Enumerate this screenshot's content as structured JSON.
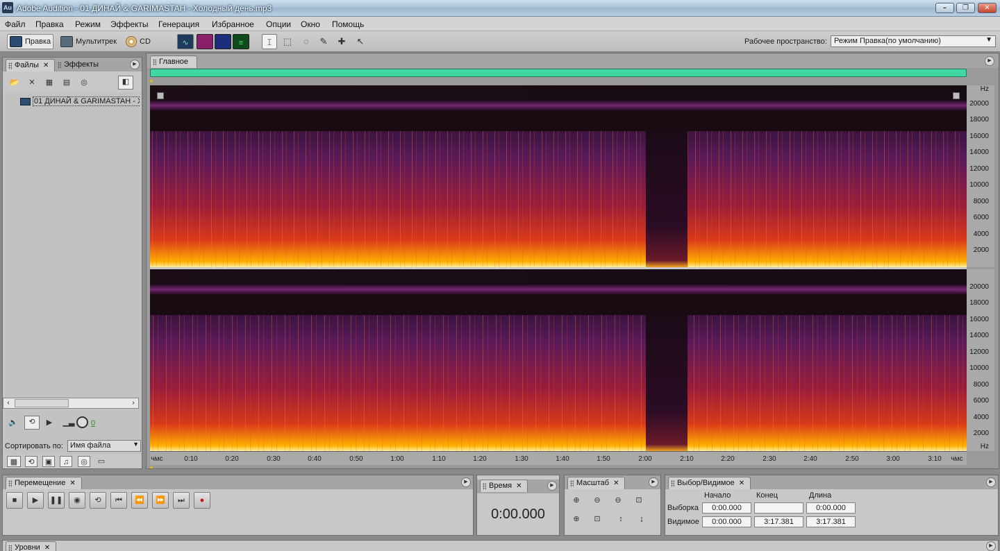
{
  "window": {
    "title": "Adobe Audition - 01 ДИНАЙ & GARIMASTAH - Холодный день.mp3",
    "app_icon": "Au"
  },
  "menu": [
    "Файл",
    "Правка",
    "Режим",
    "Эффекты",
    "Генерация",
    "Избранное",
    "Опции",
    "Окно",
    "Помощь"
  ],
  "toolbar": {
    "mode_edit": "Правка",
    "mode_multitrack": "Мультитрек",
    "mode_cd": "CD",
    "workspace_label": "Рабочее пространство:",
    "workspace_value": "Режим Правка(по умолчанию)"
  },
  "files_panel": {
    "tab_files": "Файлы",
    "tab_effects": "Эффекты",
    "file_name": "01 ДИНАЙ & GARIMASTAH - Х",
    "volume_value": "0",
    "sort_label": "Сортировать по:",
    "sort_value": "Имя файла"
  },
  "editor": {
    "tab_main": "Главное",
    "freq_unit": "Hz",
    "freq_ticks": [
      "20000",
      "18000",
      "16000",
      "14000",
      "12000",
      "10000",
      "8000",
      "6000",
      "4000",
      "2000"
    ],
    "time_ticks": [
      "чмс",
      "0:10",
      "0:20",
      "0:30",
      "0:40",
      "0:50",
      "1:00",
      "1:10",
      "1:20",
      "1:30",
      "1:40",
      "1:50",
      "2:00",
      "2:10",
      "2:20",
      "2:30",
      "2:40",
      "2:50",
      "3:00",
      "3:10",
      "чмс"
    ]
  },
  "transport": {
    "tab": "Перемещение"
  },
  "time_panel": {
    "tab": "Время",
    "value": "0:00.000"
  },
  "zoom_panel": {
    "tab": "Масштаб"
  },
  "selection_panel": {
    "tab": "Выбор/Видимое",
    "col_start": "Начало",
    "col_end": "Конец",
    "col_length": "Длина",
    "row_selection": "Выборка",
    "row_visible": "Видимое",
    "sel_start": "0:00.000",
    "sel_end": "",
    "sel_length": "0:00.000",
    "vis_start": "0:00.000",
    "vis_end": "3:17.381",
    "vis_length": "3:17.381"
  },
  "levels_panel": {
    "tab": "Уровни"
  }
}
